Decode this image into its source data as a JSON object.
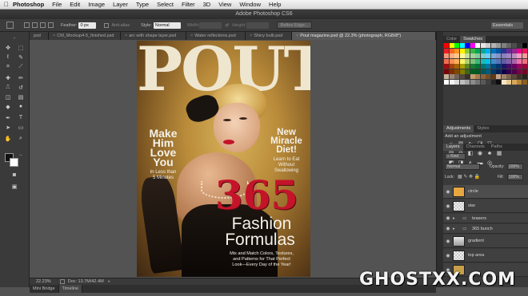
{
  "menubar": {
    "apple": "",
    "app": "Photoshop",
    "items": [
      "File",
      "Edit",
      "Image",
      "Layer",
      "Type",
      "Select",
      "Filter",
      "3D",
      "View",
      "Window",
      "Help"
    ]
  },
  "window": {
    "title": "Adobe Photoshop CS6"
  },
  "options": {
    "feather_label": "Feather:",
    "feather_value": "0 px",
    "antialias_label": "Anti-alias",
    "style_label": "Style:",
    "style_value": "Normal",
    "width_label": "Width:",
    "height_label": "Height:",
    "refine_edge": "Refine Edge...",
    "workspace": "Essentials"
  },
  "tabs": [
    {
      "label": "psd",
      "active": false
    },
    {
      "label": "CM_Mockup4-5_finished.psd",
      "active": false
    },
    {
      "label": "arc with shape layer.psd",
      "active": false
    },
    {
      "label": "Water reflections.psd",
      "active": false
    },
    {
      "label": "Shiny bulb.psd",
      "active": false
    },
    {
      "label": "Pout magazine.psd @ 22.3% (photograph, RGB/8*)",
      "active": true
    }
  ],
  "cover": {
    "title": "POUT",
    "left_headline": [
      "Make",
      "Him",
      "Love",
      "You"
    ],
    "left_sub": [
      "In Less than",
      "5 Minutes"
    ],
    "right_headline": [
      "New",
      "Miracle",
      "Diet!"
    ],
    "right_sub": [
      "Learn to Eat",
      "Without",
      "Swallowing"
    ],
    "big_number": "365",
    "fashion": "Fashion",
    "formulas": "Formulas",
    "tagline": [
      "Mix and Match Colors, Textures,",
      "and Patterns for That Perfect",
      "Look—Every Day of the Year!"
    ]
  },
  "status": {
    "zoom": "22.23%",
    "doc": "Doc: 13.7M/42.4M"
  },
  "bottom_tabs": [
    "Mini Bridge",
    "Timeline"
  ],
  "color_panel": {
    "tabs": [
      "Color",
      "Swatches"
    ],
    "active": "Swatches"
  },
  "adjust_panel": {
    "tabs": [
      "Adjustments",
      "Styles"
    ],
    "heading": "Add an adjustment"
  },
  "layers_panel": {
    "tabs": [
      "Layers",
      "Channels",
      "Paths"
    ],
    "filter_kind": "Kind",
    "blend_mode": "Normal",
    "opacity_label": "Opacity:",
    "opacity": "100%",
    "lock_label": "Lock:",
    "fill_label": "Fill:",
    "fill": "100%",
    "layers": [
      {
        "name": "circle",
        "type": "layer"
      },
      {
        "name": "star",
        "type": "layer"
      },
      {
        "name": "teasers",
        "type": "group"
      },
      {
        "name": "365 bunch",
        "type": "group"
      },
      {
        "name": "gradient",
        "type": "layer"
      },
      {
        "name": "top area",
        "type": "layer"
      },
      {
        "name": "",
        "type": "layer"
      }
    ]
  },
  "watermark": "GHOSTXX.COM",
  "colors": {
    "accent_red": "#c4142a",
    "cover_white": "#f5f1e8",
    "cover_gold": "#c9a049"
  }
}
